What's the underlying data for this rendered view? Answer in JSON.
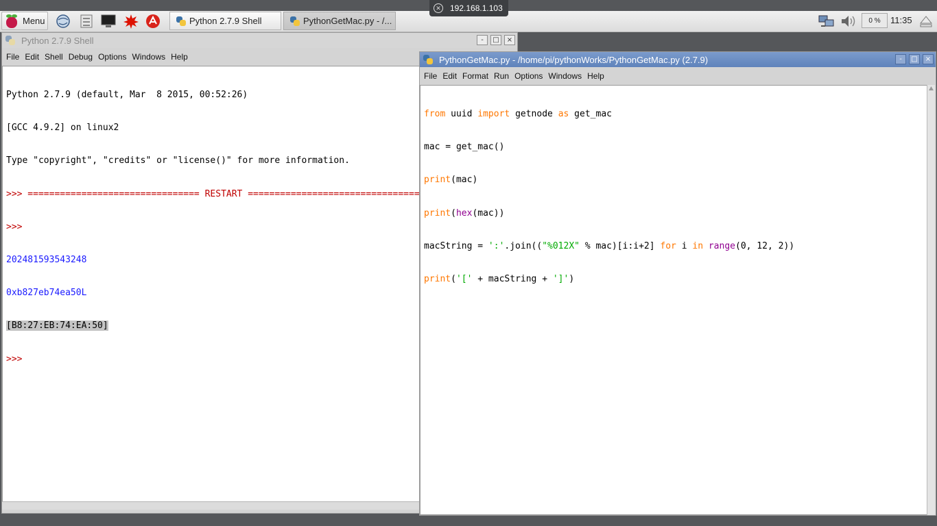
{
  "remote": {
    "address": "192.168.1.103"
  },
  "taskbar": {
    "menu_label": "Menu",
    "launchers": [
      "web-browser-icon",
      "file-manager-icon",
      "terminal-icon",
      "wolfram-icon",
      "mathematica-icon"
    ],
    "tasks": [
      {
        "label": "Python 2.7.9 Shell"
      },
      {
        "label": "PythonGetMac.py - /..."
      }
    ],
    "cpu_label": "0 %",
    "clock": "11:35"
  },
  "shell": {
    "title": "Python 2.7.9 Shell",
    "menu": [
      "File",
      "Edit",
      "Shell",
      "Debug",
      "Options",
      "Windows",
      "Help"
    ],
    "lines": [
      "Python 2.7.9 (default, Mar  8 2015, 00:52:26) ",
      "[GCC 4.9.2] on linux2",
      "Type \"copyright\", \"credits\" or \"license()\" for more information.",
      ">>> ================================ RESTART ================================",
      ">>> ",
      "202481593543248",
      "0xb827eb74ea50L",
      "[B8:27:EB:74:EA:50]",
      ">>> "
    ]
  },
  "editor": {
    "title": "PythonGetMac.py - /home/pi/pythonWorks/PythonGetMac.py (2.7.9)",
    "menu": [
      "File",
      "Edit",
      "Format",
      "Run",
      "Options",
      "Windows",
      "Help"
    ],
    "code": [
      "from uuid import getnode as get_mac",
      "mac = get_mac()",
      "print(mac)",
      "print(hex(mac))",
      "macString = ':'.join((\"%012X\" % mac)[i:i+2] for i in range(0, 12, 2))",
      "print('[' + macString + ']')"
    ]
  },
  "window_controls": {
    "minimize": "-",
    "maximize": "□",
    "close": "×"
  },
  "colors": {
    "keyword": "#ff7700",
    "builtin": "#900090",
    "string": "#00aa00",
    "output": "#1a1aff",
    "prompt": "#c00000",
    "active_titlebar": "#6d8fc3"
  }
}
